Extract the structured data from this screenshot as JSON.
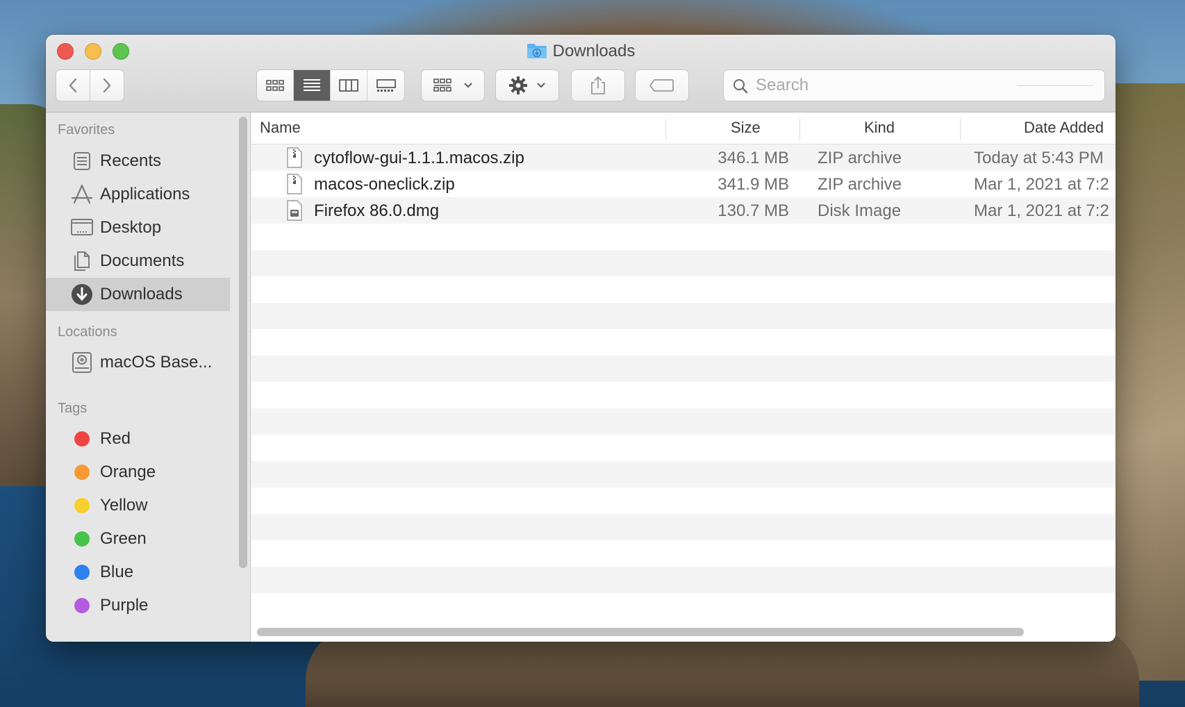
{
  "window": {
    "title": "Downloads"
  },
  "toolbar": {
    "view_modes": [
      "icon-view",
      "list-view",
      "column-view",
      "gallery-view"
    ],
    "active_view": "list-view",
    "search_placeholder": "Search"
  },
  "sidebar": {
    "favorites_heading": "Favorites",
    "favorites": [
      {
        "label": "Recents",
        "icon": "recents-icon"
      },
      {
        "label": "Applications",
        "icon": "applications-icon"
      },
      {
        "label": "Desktop",
        "icon": "desktop-icon"
      },
      {
        "label": "Documents",
        "icon": "documents-icon"
      },
      {
        "label": "Downloads",
        "icon": "downloads-icon",
        "selected": true
      }
    ],
    "locations_heading": "Locations",
    "locations": [
      {
        "label": "macOS Base...",
        "icon": "disk-icon"
      }
    ],
    "tags_heading": "Tags",
    "tags": [
      {
        "label": "Red",
        "color": "#ef4444"
      },
      {
        "label": "Orange",
        "color": "#f59a32"
      },
      {
        "label": "Yellow",
        "color": "#f7d02e"
      },
      {
        "label": "Green",
        "color": "#47c24a"
      },
      {
        "label": "Blue",
        "color": "#2f80f0"
      },
      {
        "label": "Purple",
        "color": "#b45be0"
      }
    ]
  },
  "list": {
    "columns": [
      "Name",
      "Size",
      "Kind",
      "Date Added"
    ],
    "rows": [
      {
        "name": "cytoflow-gui-1.1.1.macos.zip",
        "size": "346.1 MB",
        "kind": "ZIP archive",
        "date": "Today at 5:43 PM",
        "icon": "zip-file-icon"
      },
      {
        "name": "macos-oneclick.zip",
        "size": "341.9 MB",
        "kind": "ZIP archive",
        "date": "Mar 1, 2021 at 7:2",
        "icon": "zip-file-icon"
      },
      {
        "name": "Firefox 86.0.dmg",
        "size": "130.7 MB",
        "kind": "Disk Image",
        "date": "Mar 1, 2021 at 7:2",
        "icon": "disk-image-file-icon"
      }
    ]
  }
}
